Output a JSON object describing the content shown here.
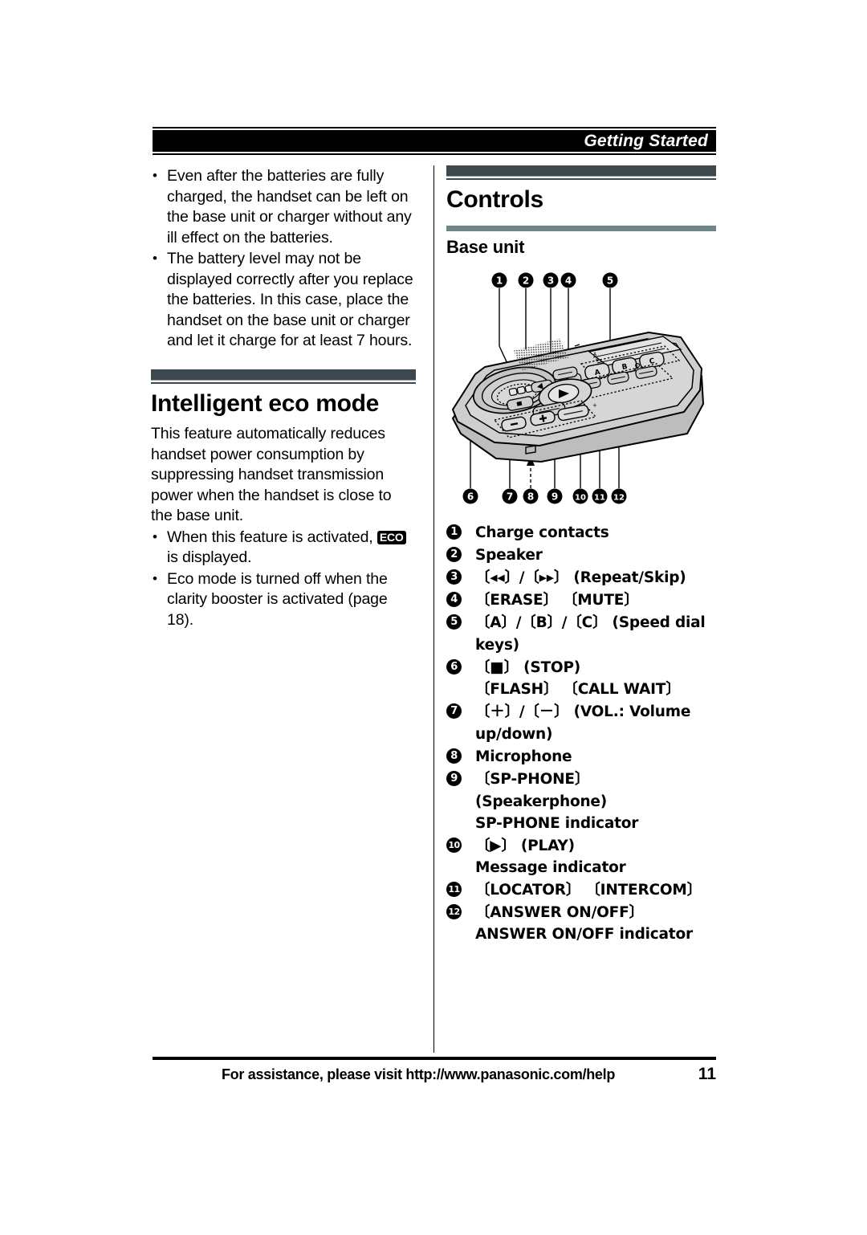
{
  "running_head": {
    "title": "Getting Started"
  },
  "left_column": {
    "top_bullets": [
      "Even after the batteries are fully charged, the handset can be left on the base unit or charger without any ill effect on the batteries.",
      "The battery level may not be displayed correctly after you replace the batteries. In this case, place the handset on the base unit or charger and let it charge for at least 7 hours."
    ],
    "section": {
      "heading": "Intelligent eco mode",
      "paragraph": "This feature automatically reduces handset power consumption by suppressing handset transmission power when the handset is close to the base unit.",
      "bullets": [
        {
          "before": "When this feature is activated,",
          "badge": "ECO",
          "after": "is displayed."
        },
        {
          "text": "Eco mode is turned off when the clarity booster is activated (page 18)."
        }
      ]
    }
  },
  "right_column": {
    "heading": "Controls",
    "subheading": "Base unit",
    "figure": {
      "caption_numbers_top": [
        "1",
        "2",
        "3",
        "4",
        "5"
      ],
      "caption_numbers_bottom": [
        "6",
        "7",
        "8",
        "9",
        "10",
        "11",
        "12"
      ],
      "keys": [
        "A",
        "B",
        "C"
      ]
    },
    "controls": [
      {
        "num": "1",
        "label": "Charge contacts"
      },
      {
        "num": "2",
        "label": "Speaker"
      },
      {
        "num": "3",
        "label": "〔◂◂〕/〔▸▸〕 (Repeat/Skip)"
      },
      {
        "num": "4",
        "label": "〔ERASE〕 〔MUTE〕"
      },
      {
        "num": "5",
        "label": "〔A〕/〔B〕/〔C〕 (Speed dial keys)"
      },
      {
        "num": "6",
        "label": "〔■〕 (STOP)",
        "sub": "〔FLASH〕 〔CALL WAIT〕"
      },
      {
        "num": "7",
        "label": "〔＋〕/〔－〕 (VOL.: Volume up/down)"
      },
      {
        "num": "8",
        "label": "Microphone"
      },
      {
        "num": "9",
        "label": "〔SP-PHONE〕 (Speakerphone)",
        "sub": "SP-PHONE indicator"
      },
      {
        "num": "10",
        "label": "〔▶〕 (PLAY)",
        "sub": "Message indicator"
      },
      {
        "num": "11",
        "label": "〔LOCATOR〕 〔INTERCOM〕"
      },
      {
        "num": "12",
        "label": "〔ANSWER ON/OFF〕",
        "sub": "ANSWER ON/OFF indicator"
      }
    ]
  },
  "footer": {
    "assistance": "For assistance, please visit http://www.panasonic.com/help",
    "page_number": "11"
  },
  "colors": {
    "heading_bar_dark": "#3d484c",
    "heading_bar_light": "#6d8589",
    "runhead_bg": "#000000",
    "runhead_text": "#ffffff",
    "body_text": "#000000",
    "device_body": "#c9c9c9",
    "device_shade": "#b0b0b0"
  }
}
